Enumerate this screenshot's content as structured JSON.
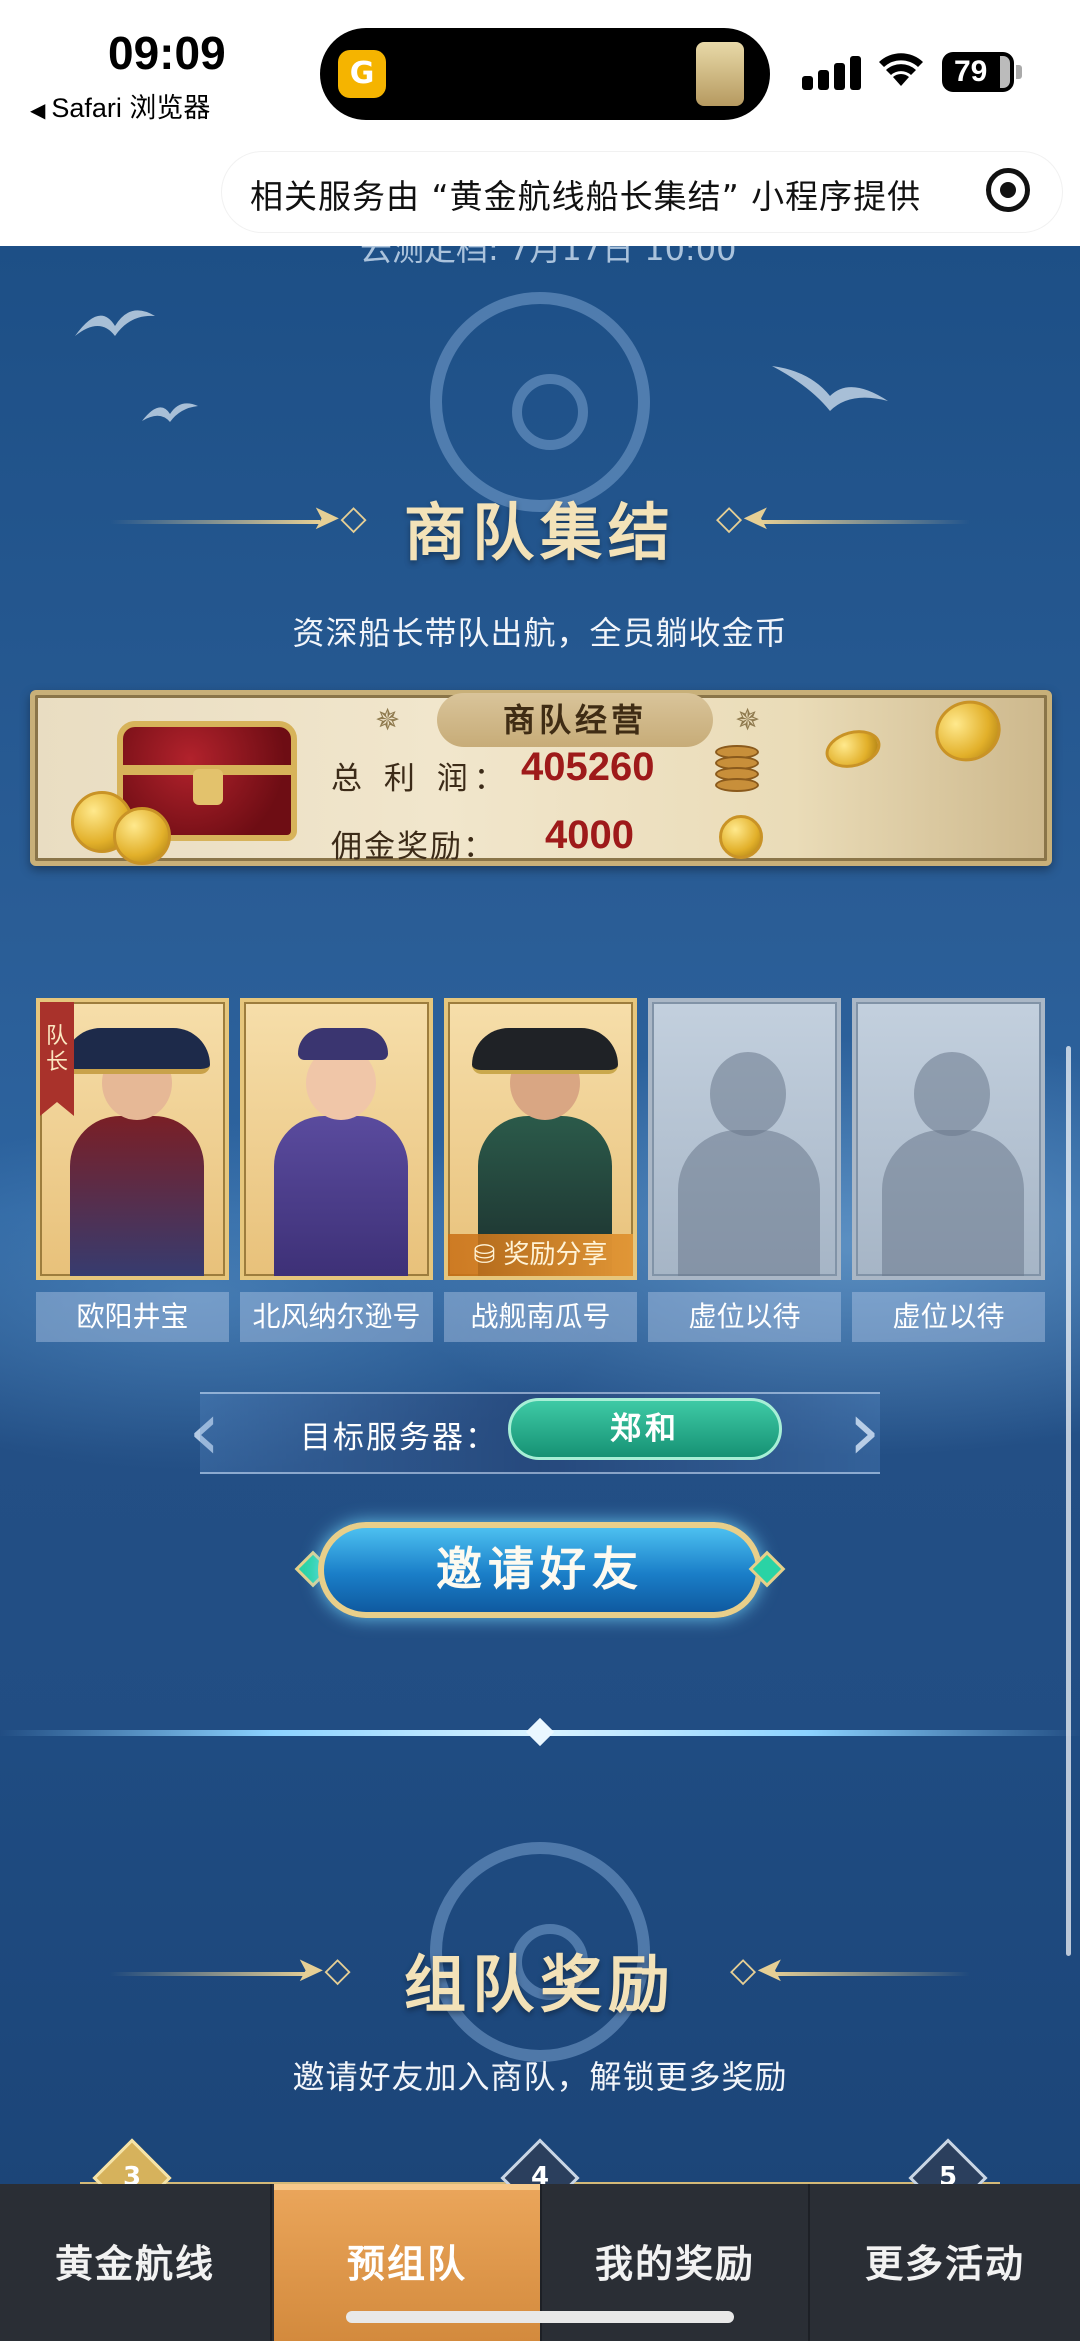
{
  "status_bar": {
    "time": "09:09",
    "back_app": "Safari 浏览器",
    "battery": "79"
  },
  "service_bar": {
    "text": "相关服务由 “黄金航线船长集结” 小程序提供"
  },
  "page": {
    "cut_off_line": "云测定档: 7月17日 10:00",
    "caravan_section": {
      "title": "商队集结",
      "subtitle": "资深船长带队出航，全员躺收金币"
    },
    "caravan_panel": {
      "tab": "商队经营",
      "total_profit_label": "总 利 润：",
      "total_profit_value": "405260",
      "commission_label": "佣金奖励：",
      "commission_value": "4000"
    },
    "members": [
      {
        "name": "欧阳井宝",
        "badge": "队长",
        "slot": "filled"
      },
      {
        "name": "北风纳尔逊号",
        "slot": "filled"
      },
      {
        "name": "战舰南瓜号",
        "badge": "奖励分享",
        "slot": "filled"
      },
      {
        "name": "虚位以待",
        "slot": "empty"
      },
      {
        "name": "虚位以待",
        "slot": "empty"
      }
    ],
    "server": {
      "label": "目标服务器：",
      "value": "郑和"
    },
    "invite_button": "邀请好友",
    "team_reward_section": {
      "title": "组队奖励",
      "subtitle": "邀请好友加入商队，解锁更多奖励"
    },
    "steps": [
      "3",
      "4",
      "5"
    ]
  },
  "tabbar": {
    "items": [
      "黄金航线",
      "预组队",
      "我的奖励",
      "更多活动"
    ],
    "active_index": 1
  },
  "colors": {
    "page_background": "#1d4f86",
    "gold_title": "#f3e2b8",
    "profit_red": "#9e1a1a",
    "server_green": "#169274",
    "tab_active": "#e09a4c",
    "tab_bar": "#2a2e35"
  }
}
